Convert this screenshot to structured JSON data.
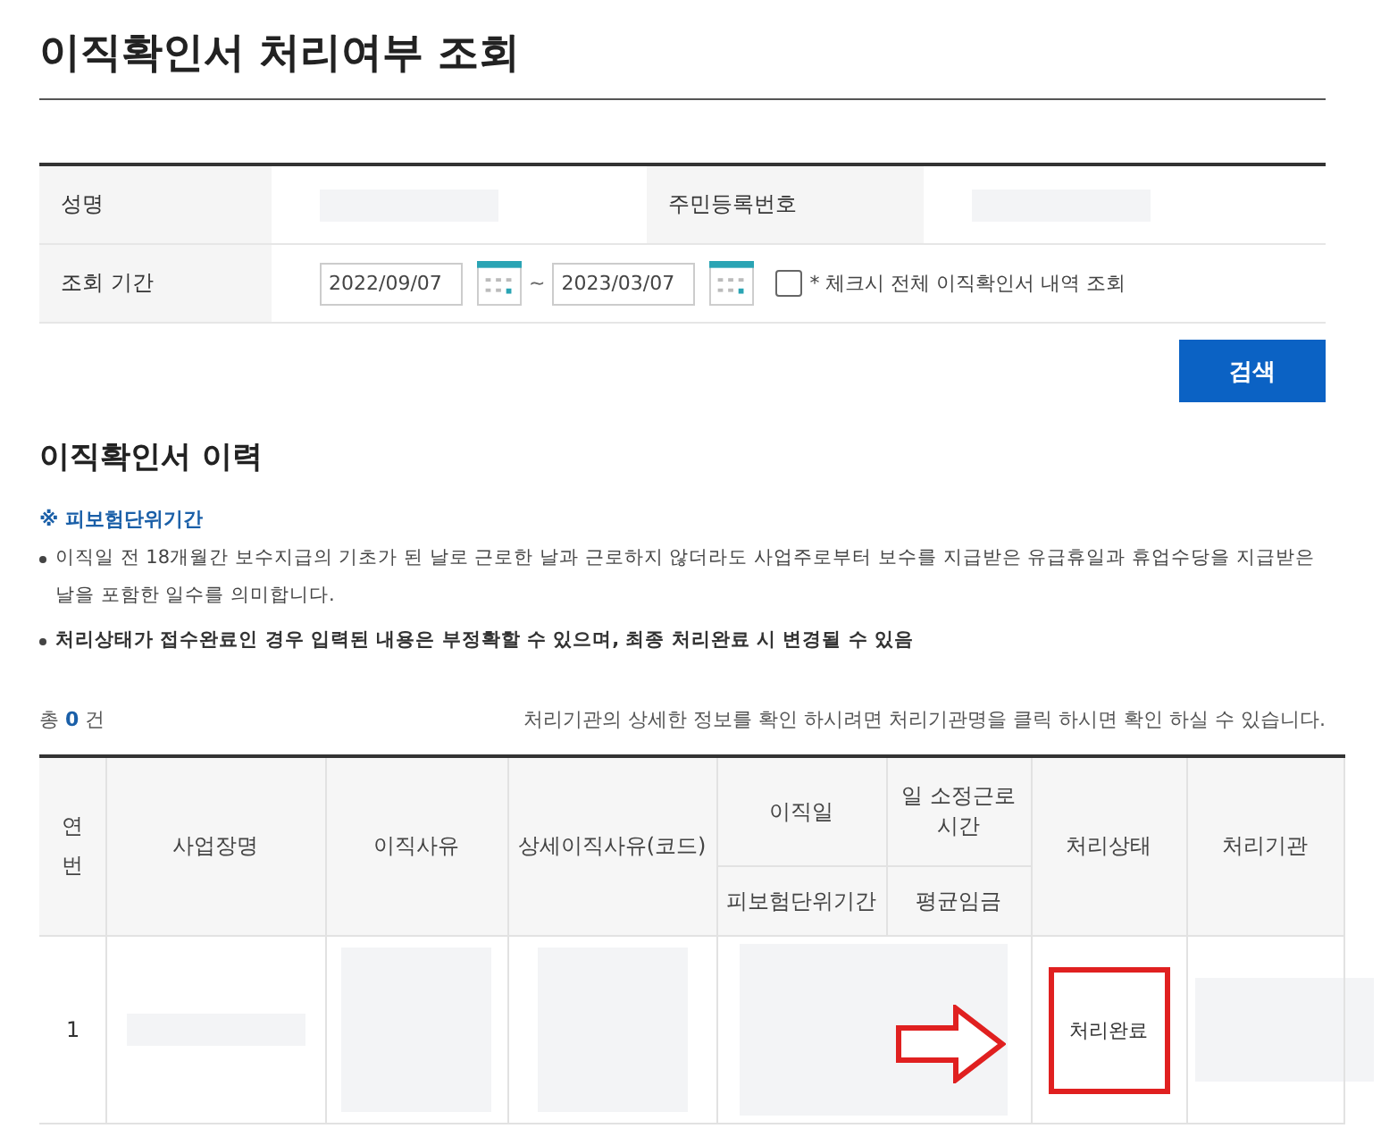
{
  "title": "이직확인서 처리여부 조회",
  "form": {
    "name_label": "성명",
    "id_label": "주민등록번호",
    "period_label": "조회 기간",
    "date_from": "2022/09/07",
    "date_sep": "~",
    "date_to": "2023/03/07",
    "all_checked": false,
    "all_label": "* 체크시 전체 이직확인서 내역 조회"
  },
  "search_button": "검색",
  "section_title": "이직확인서 이력",
  "note_title": "※ 피보험단위기간",
  "notes": [
    {
      "text": "이직일 전 18개월간 보수지급의 기초가 된 날로 근로한 날과 근로하지 않더라도 사업주로부터 보수를 지급받은 유급휴일과 휴업수당을 지급받은 날을 포함한 일수를 의미합니다.",
      "bold": false
    },
    {
      "text": "처리상태가 접수완료인 경우 입력된 내용은 부정확할 수 있으며, 최종 처리완료 시 변경될 수 있음",
      "bold": true
    }
  ],
  "count": {
    "prefix": "총",
    "value": "0",
    "suffix": "건"
  },
  "hint": "처리기관의 상세한 정보를 확인 하시려면 처리기관명을 클릭 하시면 확인 하실 수 있습니다.",
  "table": {
    "columns": {
      "no": "연번",
      "company": "사업장명",
      "reason": "이직사유",
      "detail": "상세이직사유(코드)",
      "date": "이직일",
      "hours": "일 소정근로시간",
      "status": "처리상태",
      "agency": "처리기관",
      "period": "피보험단위기간",
      "wage": "평균임금"
    },
    "rows": [
      {
        "no": "1",
        "status": "처리완료",
        "highlighted": true
      }
    ]
  }
}
